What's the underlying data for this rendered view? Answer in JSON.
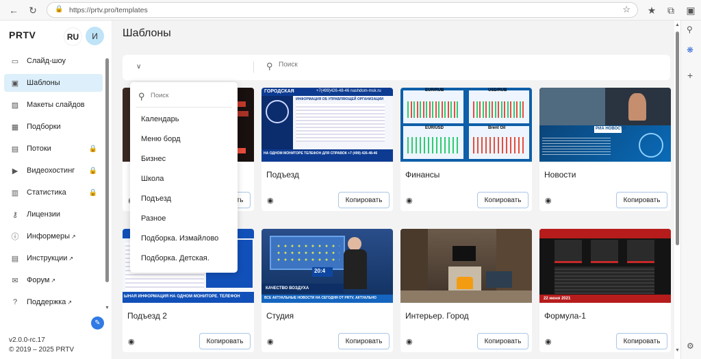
{
  "browser": {
    "url": "https://prtv.pro/templates"
  },
  "sidebar": {
    "brand": "PRTV",
    "lang": "RU",
    "avatar": "И",
    "items": [
      {
        "label": "Слайд-шоу",
        "icon": "slideshow-icon",
        "active": false,
        "locked": false,
        "external": false
      },
      {
        "label": "Шаблоны",
        "icon": "templates-icon",
        "active": true,
        "locked": false,
        "external": false
      },
      {
        "label": "Макеты слайдов",
        "icon": "image-icon",
        "active": false,
        "locked": false,
        "external": false
      },
      {
        "label": "Подборки",
        "icon": "grid-icon",
        "active": false,
        "locked": false,
        "external": false
      },
      {
        "label": "Потоки",
        "icon": "calendar-icon",
        "active": false,
        "locked": true,
        "external": false
      },
      {
        "label": "Видеохостинг",
        "icon": "video-icon",
        "active": false,
        "locked": true,
        "external": false
      },
      {
        "label": "Статистика",
        "icon": "chart-icon",
        "active": false,
        "locked": true,
        "external": false
      },
      {
        "label": "Лицензии",
        "icon": "key-icon",
        "active": false,
        "locked": false,
        "external": false
      },
      {
        "label": "Информеры",
        "icon": "info-icon",
        "active": false,
        "locked": false,
        "external": true
      },
      {
        "label": "Инструкции",
        "icon": "document-icon",
        "active": false,
        "locked": false,
        "external": true
      },
      {
        "label": "Форум",
        "icon": "chat-icon",
        "active": false,
        "locked": false,
        "external": true
      },
      {
        "label": "Поддержка",
        "icon": "support-icon",
        "active": false,
        "locked": false,
        "external": true
      }
    ],
    "version": "v2.0.0-rc.17",
    "copyright": "2019 – 2025 PRTV"
  },
  "main": {
    "title": "Шаблоны",
    "search_placeholder": "Поиск",
    "copy_label": "Копировать",
    "cards": [
      {
        "title": "",
        "theme": "dark-red"
      },
      {
        "title": "Подъезд",
        "theme": "info-blue"
      },
      {
        "title": "Финансы",
        "theme": "finance"
      },
      {
        "title": "Новости",
        "theme": "news"
      },
      {
        "title": "Подъезд 2",
        "theme": "info-blue-2"
      },
      {
        "title": "Студия",
        "theme": "studio"
      },
      {
        "title": "Интерьер. Город",
        "theme": "interior"
      },
      {
        "title": "Формула-1",
        "theme": "f1"
      }
    ],
    "thumb_text": {
      "podezd_header": "ГОРОДСКАЯ",
      "podezd_phone": "+7(499)426-48-46",
      "podezd_site": "nashdom-msk.ru",
      "podezd_info": "ИНФОРМАЦИЯ ОБ УПРАВЛЯЮЩЕЙ ОРГАНИЗАЦИИ",
      "podezd_ticker": "НА ОДНОМ МОНИТОРЕ ТЕЛЕФОН ДЛЯ СПРАВОК +7 (499) 426-48-46",
      "fin_labels": [
        "EUR/RUB",
        "USD/RUB",
        "EUR/USD",
        "Brent Oil"
      ],
      "news_brand": "РИА НОВОСТИ",
      "studio_time": "20:4",
      "studio_caption": "КАЧЕСТВО ВОЗДУХА",
      "studio_ticker": "ВСЕ АКТУАЛЬНЫЕ НОВОСТИ НА СЕГОДНЯ ОТ PRTV. АКТУАЛЬНО",
      "podezd2_ticker": "ЫНАЯ ИНФОРМАЦИЯ НА ОДНОМ МОНИТОРЕ. ТЕЛЕФОН",
      "f1_date": "22 июня 2021"
    }
  },
  "dropdown": {
    "search_placeholder": "Поиск",
    "options": [
      "Календарь",
      "Меню борд",
      "Бизнес",
      "Школа",
      "Подъезд",
      "Разное",
      "Подборка. Измайлово",
      "Подборка. Детская."
    ]
  },
  "colors": {
    "accent": "#2f7ae5",
    "active_bg": "#dceffa"
  }
}
